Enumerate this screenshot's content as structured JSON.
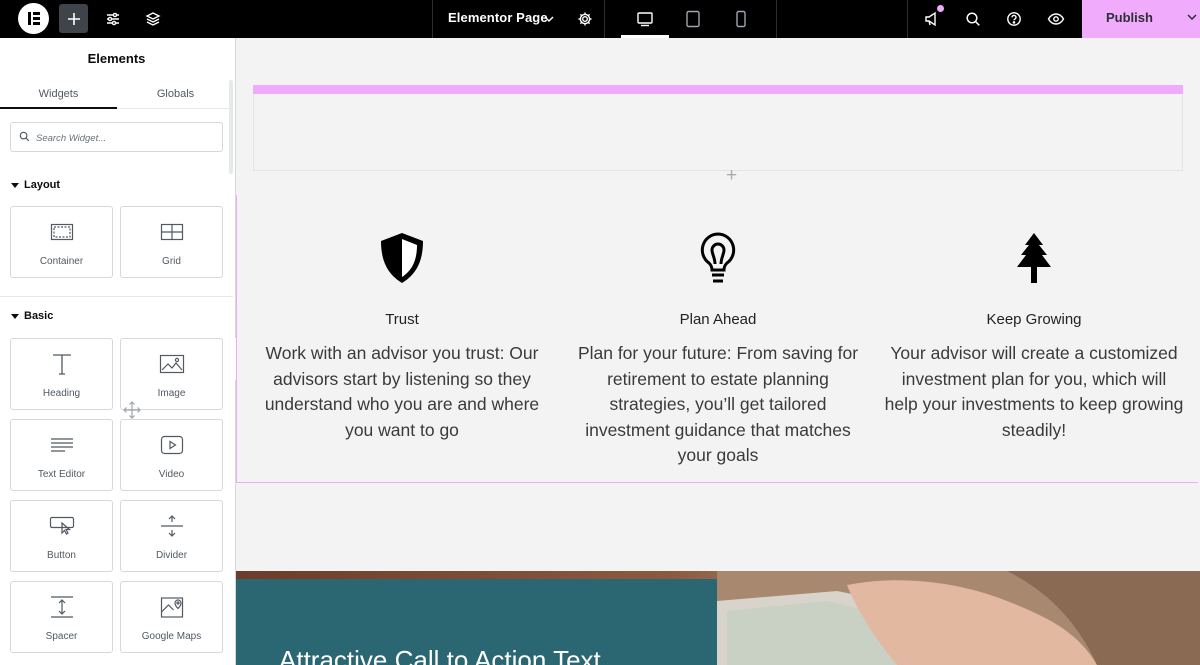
{
  "topbar": {
    "page_name": "Elementor Page",
    "publish_label": "Publish"
  },
  "sidebar": {
    "title": "Elements",
    "tabs": [
      "Widgets",
      "Globals"
    ],
    "search_placeholder": "Search Widget...",
    "categories": {
      "layout": {
        "label": "Layout",
        "widgets": [
          "Container",
          "Grid"
        ]
      },
      "basic": {
        "label": "Basic",
        "widgets": [
          "Heading",
          "Image",
          "Text Editor",
          "Video",
          "Button",
          "Divider",
          "Spacer",
          "Google Maps"
        ]
      }
    }
  },
  "canvas": {
    "features": [
      {
        "title": "Trust",
        "text": "Work with an advisor you trust: Our advisors start by listening so they understand who you are and where you want to go"
      },
      {
        "title": "Plan Ahead",
        "text": "Plan for your future: From saving for retirement to estate planning strategies, you’ll get tailored investment guidance that matches your goals"
      },
      {
        "title": "Keep Growing",
        "text": "Your advisor will create a customized investment plan for you, which will help your investments to keep growing steadily!"
      }
    ],
    "cta_title": "Attractive Call to Action Text"
  },
  "colors": {
    "accent": "#f0abfc",
    "cta_panel": "#2b6773",
    "topbar": "#000000"
  },
  "icons": [
    "elementor-logo-icon",
    "plus-icon",
    "sliders-icon",
    "layers-icon",
    "chevron-down-icon",
    "gear-icon",
    "desktop-icon",
    "tablet-icon",
    "mobile-icon",
    "megaphone-icon",
    "search-icon",
    "help-icon",
    "eye-icon",
    "shield-icon",
    "lightbulb-icon",
    "tree-icon"
  ]
}
